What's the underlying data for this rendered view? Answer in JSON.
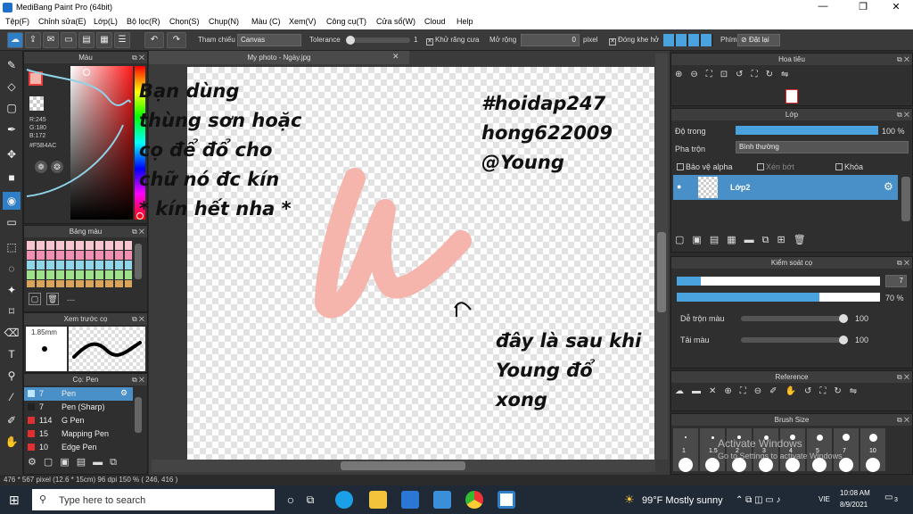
{
  "window": {
    "title": "MediBang Paint Pro (64bit)",
    "min": "—",
    "max": "❐",
    "close": "✕"
  },
  "menu": [
    "Tệp(F)",
    "Chỉnh sửa(E)",
    "Lớp(L)",
    "Bộ lọc(R)",
    "Chọn(S)",
    "Chụp(N)",
    "Màu (C)",
    "Xem(V)",
    "Công cụ(T)",
    "Cửa sổ(W)",
    "Cloud",
    "Help"
  ],
  "toolbar": {
    "reference_label": "Tham chiếu",
    "reference_value": "Canvas",
    "tolerance_label": "Tolerance",
    "tolerance_value": "1",
    "antialias_label": "Khử răng cưa",
    "expand_label": "Mở rộng",
    "expand_value": "0",
    "expand_unit": "pixel",
    "close_gap_label": "Đóng khe hở",
    "key_label": "Phím",
    "reset_label": "Đặt lại"
  },
  "color_panel": {
    "title": "Màu",
    "r": "R:245",
    "g": "G:180",
    "b": "B:172",
    "hex": "#F5B4AC",
    "fg": "#f5b4ac"
  },
  "swatch_panel": {
    "title": "Bảng màu",
    "extra": "---"
  },
  "preview_panel": {
    "title": "Xem trước cọ",
    "size": "1.85mm"
  },
  "brush_panel": {
    "title": "Cọ: Pen",
    "brushes": [
      {
        "size": "7",
        "name": "Pen",
        "color": "#bde6ff",
        "selected": true
      },
      {
        "size": "7",
        "name": "Pen (Sharp)",
        "color": "#222222",
        "selected": false
      },
      {
        "size": "114",
        "name": "G Pen",
        "color": "#e03030",
        "selected": false
      },
      {
        "size": "15",
        "name": "Mapping Pen",
        "color": "#e03030",
        "selected": false
      },
      {
        "size": "10",
        "name": "Edge Pen",
        "color": "#e03030",
        "selected": false
      }
    ]
  },
  "document": {
    "tab": "My photo - Ngày.jpg",
    "stroke_color": "#f5b4ac"
  },
  "notes": {
    "left": "Bạn dùng\nthùng sơn hoặc\ncọ để đổ cho\nchữ nó đc kín\n* kín hết nha *",
    "right": "#hoidap247\nhong622009\n@Young",
    "bottom": "đây là sau khi\nYoung đổ\nxong"
  },
  "navigator": {
    "title": "Hoa tiêu"
  },
  "layer_panel": {
    "title": "Lớp",
    "opacity_label": "Độ trong",
    "opacity_value": "100 %",
    "blend_label": "Pha trộn",
    "blend_value": "Bình thường",
    "protect_alpha": "Bảo vệ alpha",
    "clipping": "Xén bớt",
    "lock": "Khóa",
    "layer_name": "Lớp2"
  },
  "brush_control": {
    "title": "Kiểm soát cọ",
    "size_value": "7",
    "size_fraction": 0.12,
    "opacity_value": "70 %",
    "opacity_fraction": 0.7,
    "blend_label": "Dễ trộn màu",
    "blend_value": "100",
    "blend_fraction": 1.0,
    "paint_label": "Tải màu",
    "paint_value": "100",
    "paint_fraction": 1.0
  },
  "reference_panel": {
    "title": "Reference"
  },
  "brush_size_panel": {
    "title": "Brush Size",
    "sizes": [
      "1",
      "1.5",
      "2",
      "3",
      "4",
      "5",
      "7",
      "10"
    ],
    "watermark_title": "Activate Windows",
    "watermark_sub": "Go to Settings to activate Windows."
  },
  "status": {
    "text": "476 * 567 pixel  (12.6 * 15cm)  96 dpi  150 %  ( 246, 416 )"
  },
  "taskbar": {
    "search": "Type here to search",
    "weather": "99°F  Mostly sunny",
    "lang": "VIE",
    "time": "10:08 AM",
    "date": "8/9/2021",
    "notif": "3"
  },
  "colors": {
    "accent": "#4aa3df",
    "panel": "#2f2f2f"
  }
}
